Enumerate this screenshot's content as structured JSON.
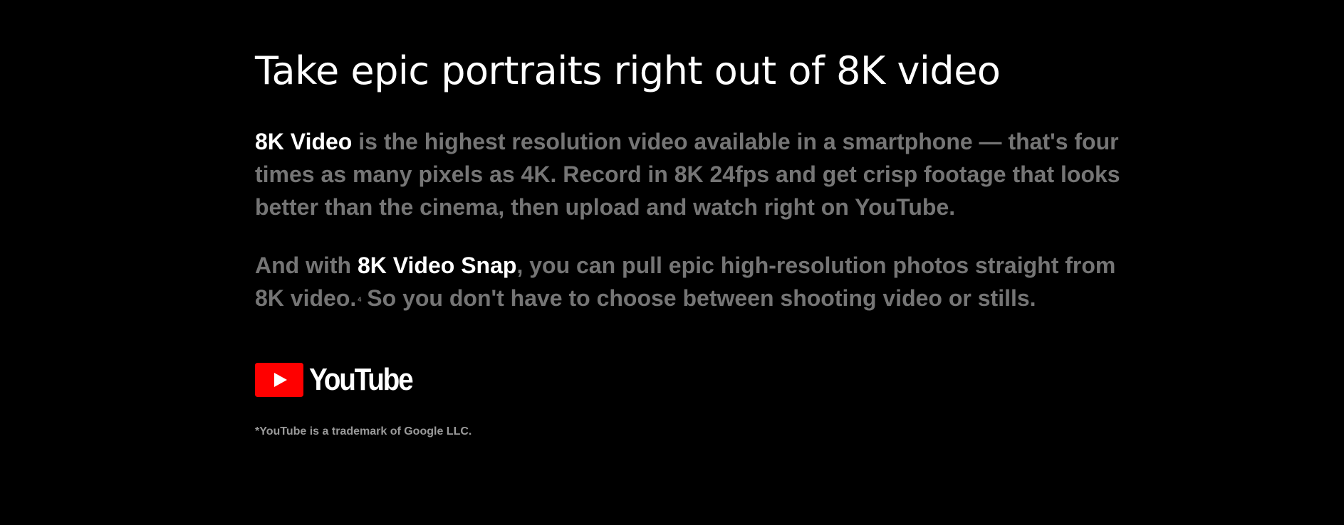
{
  "headline": "Take epic portraits right out of 8K video",
  "paragraph1": {
    "highlight": "8K Video",
    "rest": " is the highest resolution video available in a smartphone — that's four times as many pixels as 4K. Record in 8K 24fps and get crisp footage that looks better than the cinema, then upload and watch right on YouTube."
  },
  "paragraph2": {
    "lead": "And with ",
    "highlight": "8K Video Snap",
    "middle": ", you can pull epic high-resolution photos straight from 8K video.",
    "footnote": "4",
    "tail": "So you don't have to choose between shooting video or stills."
  },
  "logo": {
    "icon": "youtube-play-icon",
    "wordmark": "YouTube",
    "brand_color": "#FF0000"
  },
  "disclaimer": "*YouTube is a trademark of Google LLC.",
  "colors": {
    "background": "#000000",
    "highlight_text": "#FFFFFF",
    "body_text": "#757575"
  }
}
